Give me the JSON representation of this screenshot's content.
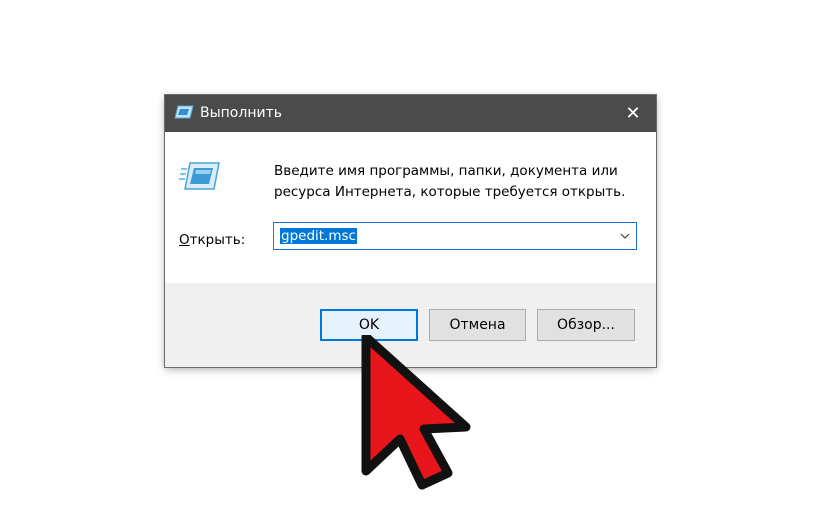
{
  "dialog": {
    "title": "Выполнить",
    "close_glyph": "✕",
    "description": "Введите имя программы, папки, документа или ресурса Интернета, которые требуется открыть.",
    "open_label_prefix": "О",
    "open_label_rest": "ткрыть:",
    "input_value": "gpedit.msc",
    "buttons": {
      "ok": "OK",
      "cancel": "Отмена",
      "browse": "Обзор..."
    }
  },
  "icons": {
    "title": "run-icon",
    "main": "run-icon",
    "close": "close-icon",
    "dropdown": "chevron-down-icon",
    "pointer": "cursor-arrow-icon"
  },
  "colors": {
    "titlebar": "#4b4b4b",
    "accent": "#0078d7",
    "cursor_fill": "#e8161b"
  }
}
